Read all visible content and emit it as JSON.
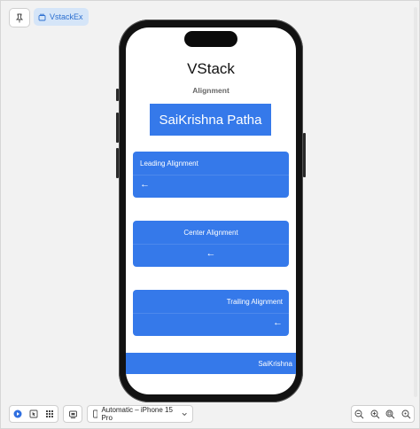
{
  "toolbar": {
    "preview_label": "VstackEx"
  },
  "device": {
    "selector_label": "Automatic – iPhone 15 Pro"
  },
  "screen": {
    "title": "VStack",
    "subtitle": "Alignment",
    "name_box": "SaiKrishna Patha",
    "cards": [
      {
        "label": "Leading Alignment",
        "arrow": "←"
      },
      {
        "label": "Center Alignment",
        "arrow": "←"
      },
      {
        "label": "Trailing Alignment",
        "arrow": "←"
      }
    ],
    "band_text": "SaiKrishna"
  },
  "colors": {
    "accent_blue": "#3579ea",
    "chip_bg": "#d5e5f8",
    "chip_text": "#2c6fd0",
    "phone_body": "#121212"
  },
  "icons": {
    "pin": "pin-icon",
    "preview": "square-stack-icon",
    "live": "play-icon",
    "selectable": "cursor-icon",
    "variants": "grid-icon",
    "device_settings": "device-settings-icon",
    "iphone": "iphone-icon",
    "zoom": [
      "zoom-out-icon",
      "zoom-in-icon",
      "zoom-to-fit-icon",
      "zoom-actual-icon"
    ]
  }
}
